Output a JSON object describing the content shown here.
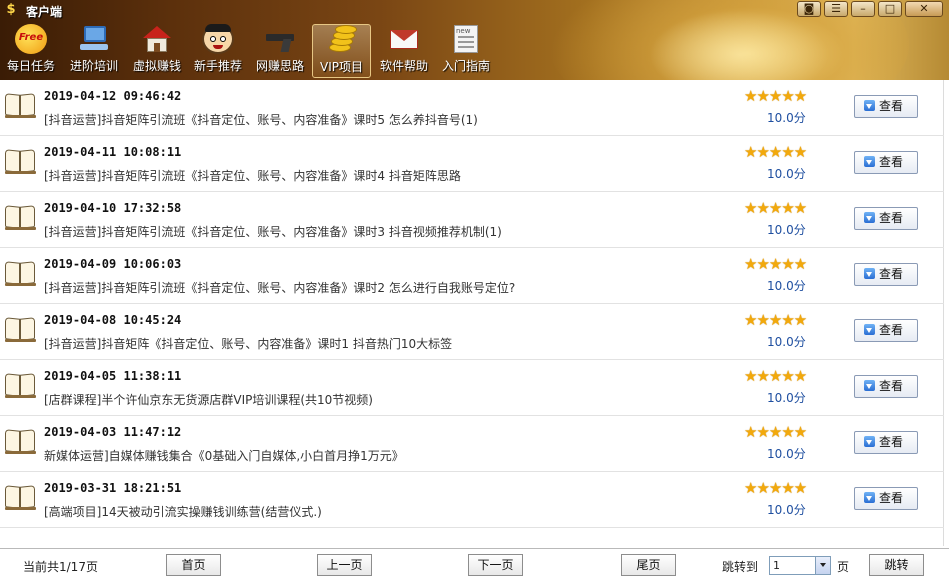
{
  "app": {
    "title": "客户端",
    "icon_glyph": "$"
  },
  "window_controls": {
    "help_glyph": "◙",
    "menu_glyph": "☰",
    "minimize_glyph": "–",
    "maximize_glyph": "□",
    "close_glyph": "✕"
  },
  "toolbar": {
    "items": [
      {
        "label": "每日任务",
        "icon": "free-icon",
        "badge": "Free"
      },
      {
        "label": "进阶培训",
        "icon": "computer-icon"
      },
      {
        "label": "虚拟赚钱",
        "icon": "house-icon"
      },
      {
        "label": "新手推荐",
        "icon": "face-icon"
      },
      {
        "label": "网赚思路",
        "icon": "gun-icon"
      },
      {
        "label": "VIP项目",
        "icon": "coins-icon",
        "active": true
      },
      {
        "label": "软件帮助",
        "icon": "mail-icon"
      },
      {
        "label": "入门指南",
        "icon": "newspaper-icon",
        "badge": "new"
      }
    ]
  },
  "list": {
    "view_label": "查看",
    "stars": "★★★★★",
    "items": [
      {
        "date": "2019-04-12 09:46:42",
        "title": "[抖音运营]抖音矩阵引流班《抖音定位、账号、内容准备》课时5 怎么养抖音号(1)",
        "score": "10.0分"
      },
      {
        "date": "2019-04-11 10:08:11",
        "title": "[抖音运营]抖音矩阵引流班《抖音定位、账号、内容准备》课时4 抖音矩阵思路",
        "score": "10.0分"
      },
      {
        "date": "2019-04-10 17:32:58",
        "title": "[抖音运营]抖音矩阵引流班《抖音定位、账号、内容准备》课时3 抖音视频推荐机制(1)",
        "score": "10.0分"
      },
      {
        "date": "2019-04-09 10:06:03",
        "title": "[抖音运营]抖音矩阵引流班《抖音定位、账号、内容准备》课时2 怎么进行自我账号定位?",
        "score": "10.0分"
      },
      {
        "date": "2019-04-08 10:45:24",
        "title": "[抖音运营]抖音矩阵《抖音定位、账号、内容准备》课时1 抖音热门10大标签",
        "score": "10.0分"
      },
      {
        "date": "2019-04-05 11:38:11",
        "title": "[店群课程]半个许仙京东无货源店群VIP培训课程(共10节视频)",
        "score": "10.0分"
      },
      {
        "date": "2019-04-03 11:47:12",
        "title": "新媒体运营]自媒体赚钱集合《0基础入门自媒体,小白首月挣1万元》",
        "score": "10.0分"
      },
      {
        "date": "2019-03-31 18:21:51",
        "title": "[高端项目]14天被动引流实操赚钱训练营(结营仪式.)",
        "score": "10.0分"
      }
    ]
  },
  "footer": {
    "page_info": "当前共1/17页",
    "first": "首页",
    "prev": "上一页",
    "next": "下一页",
    "last": "尾页",
    "jump_to": "跳转到",
    "page_value": "1",
    "page_unit": "页",
    "go": "跳转"
  }
}
